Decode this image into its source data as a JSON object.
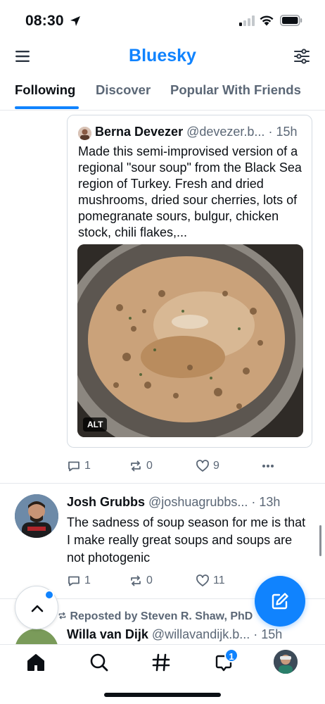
{
  "status_bar": {
    "time": "08:30"
  },
  "header": {
    "title": "Bluesky",
    "menu_icon": "hamburger-menu-icon",
    "filter_icon": "sliders-icon",
    "accent_color": "#1083fe"
  },
  "tabs": [
    {
      "label": "Following",
      "active": true
    },
    {
      "label": "Discover",
      "active": false
    },
    {
      "label": "Popular With Friends",
      "active": false
    }
  ],
  "quoted_post": {
    "author_name": "Berna Devezer",
    "handle": "@devezer.b...",
    "time": "· 15h",
    "text": "Made this semi-improvised version of a regional \"sour soup\" from the Black Sea region of Turkey. Fresh and dried mushrooms, dried sour cherries, lots of pomegranate sours, bulgur, chicken stock, chili flakes,...",
    "image_alt_badge": "ALT"
  },
  "quoted_post_actions": {
    "replies": "1",
    "reposts": "0",
    "likes": "9"
  },
  "post": {
    "author_name": "Josh Grubbs",
    "handle": "@joshuagrubbs...",
    "time": "· 13h",
    "text": "The sadness of soup season for me is that I make really great soups and soups are not photogenic"
  },
  "post_actions": {
    "replies": "1",
    "reposts": "0",
    "likes": "11"
  },
  "next_post": {
    "repost_label": "Reposted by Steven R. Shaw, PhD",
    "author_name": "Willa van Dijk",
    "handle": "@willavandijk.b...",
    "time": "· 15h"
  },
  "bottom_nav": {
    "notifications_badge": "1",
    "items": [
      "home-icon",
      "search-icon",
      "hashtag-icon",
      "notifications-icon",
      "profile-avatar"
    ]
  }
}
